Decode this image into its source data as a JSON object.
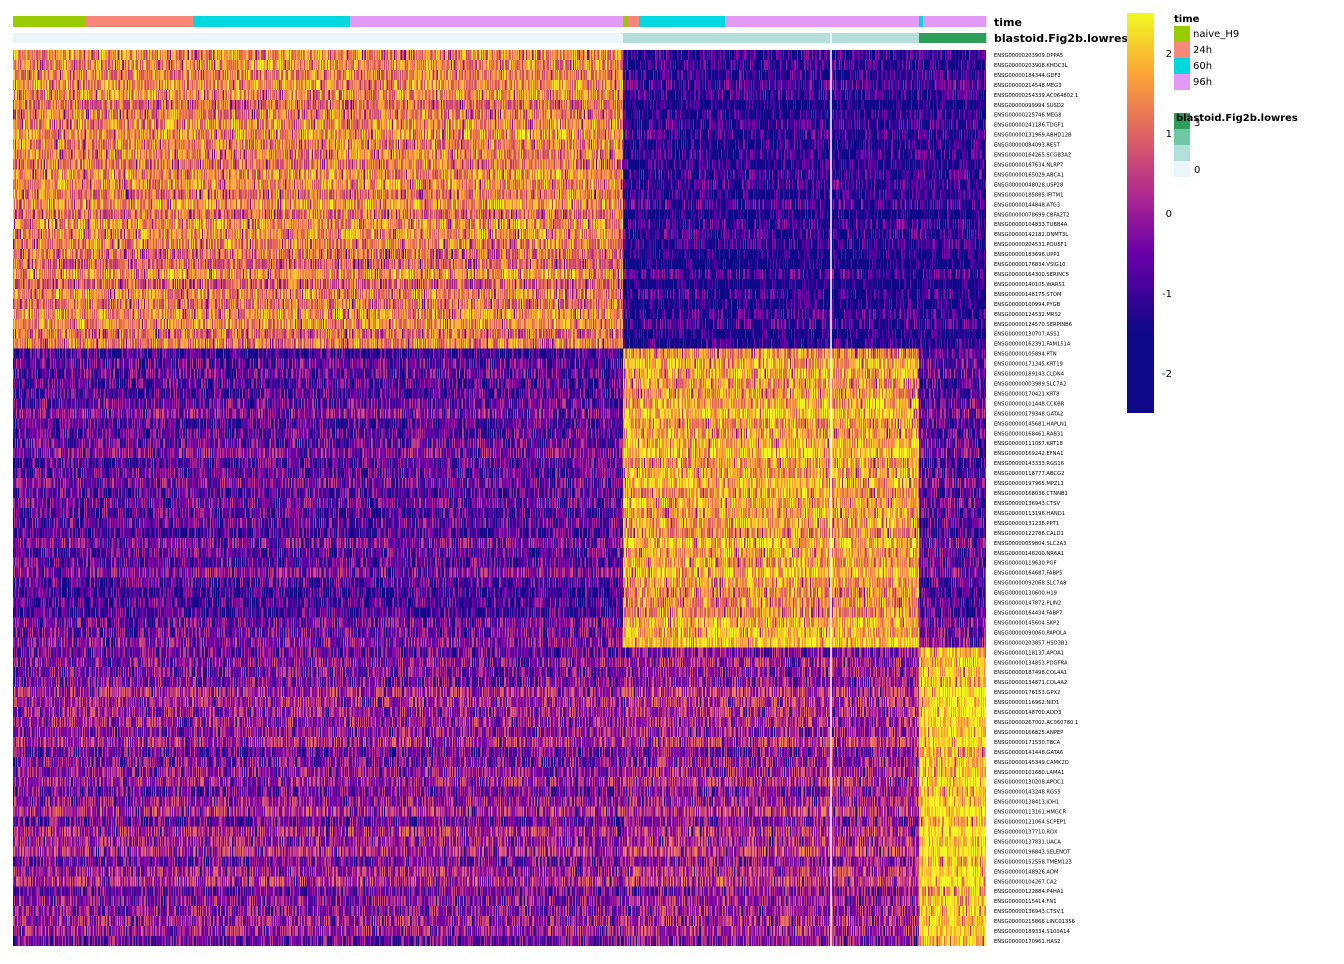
{
  "chart_data": {
    "type": "heatmap",
    "annotation_tracks": [
      {
        "name": "time",
        "segments": [
          {
            "label": "naive_H9",
            "cells": 73
          },
          {
            "label": "24h",
            "cells": 107
          },
          {
            "label": "60h",
            "cells": 157
          },
          {
            "label": "96h",
            "cells": 273
          },
          {
            "label": "naive_H9",
            "cells": 5
          },
          {
            "label": "24h",
            "cells": 11
          },
          {
            "label": "60h",
            "cells": 86
          },
          {
            "label": "96h",
            "cells": 194
          },
          {
            "label": "60h",
            "cells": 4
          },
          {
            "label": "96h",
            "cells": 63
          }
        ]
      },
      {
        "name": "blastoid.Fig2b.lowres",
        "segments": [
          {
            "value": 0,
            "cells": 610
          },
          {
            "value": 1,
            "cells": 296
          },
          {
            "value": 3,
            "cells": 67
          }
        ]
      }
    ],
    "column_gaps_after_cell": [
      818
    ],
    "genes": [
      "ENSG00000203909.DPPA5",
      "ENSG00000203908.KHDC3L",
      "ENSG00000184344.GDF3",
      "ENSG00000214548.MEG3",
      "ENSG00000254339.AC064802.1",
      "ENSG00000099994.SUSD2",
      "ENSG00000225746.MEG8",
      "ENSG00000241186.TDGF1",
      "ENSG00000131969.ABHD12B",
      "ENSG00000084093.REST",
      "ENSG00000164265.SCGB3A2",
      "ENSG00000167634.NLRP7",
      "ENSG00000165029.ABCA1",
      "ENSG00000048028.USP28",
      "ENSG00000185885.IFITM1",
      "ENSG00000144848.ATG3",
      "ENSG00000078699.CBFA2T2",
      "ENSG00000104833.TUBB4A",
      "ENSG00000142182.DNMT3L",
      "ENSG00000204531.POU5F1",
      "ENSG00000183696.UPP1",
      "ENSG00000176834.VSIG10",
      "ENSG00000164300.SERINC5",
      "ENSG00000140105.WARS1",
      "ENSG00000148175.STOM",
      "ENSG00000100994.PYGB",
      "ENSG00000124532.MRS2",
      "ENSG00000124570.SERPINB6",
      "ENSG00000130707.ASS1",
      "ENSG00000162391.FAM151A",
      "ENSG00000105894.PTN",
      "ENSG00000171345.KRT19",
      "ENSG00000189143.CLDN4",
      "ENSG00000003989.SLC7A2",
      "ENSG00000170421.KRT8",
      "ENSG00000101448.CCKBR",
      "ENSG00000179348.GATA2",
      "ENSG00000145681.HAPLN1",
      "ENSG00000168461.RAB31",
      "ENSG00000111057.KRT18",
      "ENSG00000169242.EFNA1",
      "ENSG00000143333.RGS16",
      "ENSG00000118777.ABCG2",
      "ENSG00000197965.MPZL1",
      "ENSG00000168036.CTNNB1",
      "ENSG00000136943.CTSV",
      "ENSG00000113196.HAND1",
      "ENSG00000131238.PPT1",
      "ENSG00000122786.CALD1",
      "ENSG00000059804.SLC2A3",
      "ENSG00000148200.NR6A1",
      "ENSG00000119630.PGF",
      "ENSG00000164687.FABP5",
      "ENSG00000092068.SLC7A8",
      "ENSG00000130600.H19",
      "ENSG00000147872.PLIN2",
      "ENSG00000164434.FABP7",
      "ENSG00000145604.SKP2",
      "ENSG00000090060.PAPOLA",
      "ENSG00000203857.HSD3B1",
      "ENSG00000118137.APOA1",
      "ENSG00000134853.PDGFRA",
      "ENSG00000187498.COL4A1",
      "ENSG00000134871.COL4A2",
      "ENSG00000176153.GPX2",
      "ENSG00000116962.NID1",
      "ENSG00000148700.ADD3",
      "ENSG00000267002.AC060780.1",
      "ENSG00000166825.ANPEP",
      "ENSG00000171530.TBCA",
      "ENSG00000141448.GATA6",
      "ENSG00000145349.CAMK2D",
      "ENSG00000101680.LAMA1",
      "ENSG00000130208.APOC1",
      "ENSG00000143248.RGS5",
      "ENSG00000138413.IDH1",
      "ENSG00000113161.HMGCR",
      "ENSG00000121064.SCPEP1",
      "ENSG00000137710.RDX",
      "ENSG00000137831.UACA",
      "ENSG00000198843.SELENOT",
      "ENSG00000152558.TMEM123",
      "ENSG00000148926.ADM",
      "ENSG00000104267.CA2",
      "ENSG00000122884.P4HA1",
      "ENSG00000115414.FN1",
      "ENSG00000136943.CTSV.1",
      "ENSG00000215866.LINC01356",
      "ENSG00000189334.S100A14",
      "ENSG00000170961.HAS2"
    ],
    "gene_modules": [
      {
        "genes_count": 30,
        "expression_by_segment": [
          1.0,
          1.0,
          1.0,
          1.0,
          -2.2,
          -2.2,
          -2.2,
          -2.2,
          -2.2,
          -2.2
        ]
      },
      {
        "genes_count": 30,
        "expression_by_segment": [
          -1.3,
          -1.3,
          -1.3,
          -1.3,
          1.7,
          1.7,
          1.6,
          1.6,
          -1.3,
          -1.3
        ]
      },
      {
        "genes_count": 30,
        "expression_by_segment": [
          -0.8,
          -0.8,
          -0.8,
          -0.8,
          -0.5,
          -0.5,
          -0.5,
          -0.5,
          2.2,
          2.2
        ]
      }
    ],
    "legends": {
      "time": {
        "title": "time",
        "entries": [
          {
            "label": "naive_H9",
            "color": "#99CC00"
          },
          {
            "label": "24h",
            "color": "#F8877A"
          },
          {
            "label": "60h",
            "color": "#00D8E0"
          },
          {
            "label": "96h",
            "color": "#E39AF6"
          }
        ]
      },
      "blastoid": {
        "title": "blastoid.Fig2b.lowres",
        "ticks": [
          "3",
          "0"
        ],
        "colors": [
          "#2E9F5A",
          "#70C8A6",
          "#B3E1DA",
          "#EAF6F8"
        ]
      },
      "expression": {
        "ticks": [
          2,
          1,
          0,
          -1,
          -2
        ],
        "range": [
          -2.5,
          2.5
        ],
        "palette": "plasma"
      }
    },
    "labels": {
      "track_time": "time",
      "track_blastoid": "blastoid.Fig2b.lowres"
    },
    "colors": {
      "naive_H9": "#99CC00",
      "24h": "#F8877A",
      "60h": "#00D8E0",
      "96h": "#E39AF6",
      "low": "#0D0887",
      "high": "#F0F921"
    }
  }
}
